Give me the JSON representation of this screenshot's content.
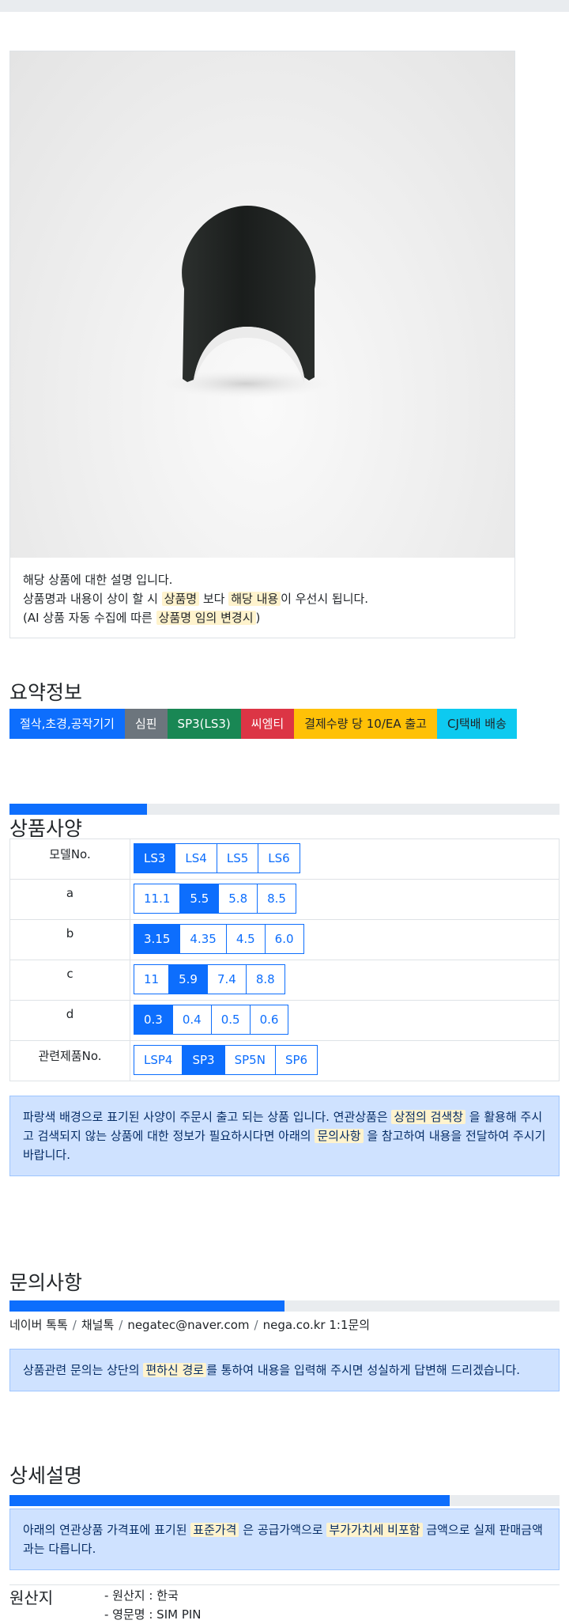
{
  "product": {
    "description_lines": [
      {
        "text": "해당 상품에 대한 설명 입니다."
      },
      {
        "pre": "상품명과 내용이 상이 할 시 ",
        "hl1": "상품명",
        "mid": " 보다 ",
        "hl2": "해당 내용",
        "post": "이 우선시 됩니다."
      },
      {
        "pre": "(AI 상품 자동 수집에 따른 ",
        "hl1": "상품명 임의 변경시",
        "post": ")"
      }
    ]
  },
  "summary": {
    "title": "요약정보",
    "badges": [
      {
        "label": "절삭,초경,공작기기",
        "color": "#0d6efd"
      },
      {
        "label": "심핀",
        "color": "#6c757d"
      },
      {
        "label": "SP3(LS3)",
        "color": "#198754"
      },
      {
        "label": "씨엠티",
        "color": "#dc3545"
      },
      {
        "label": "결제수량 당 10/EA 출고",
        "color": "#ffc107"
      },
      {
        "label": "CJ택배 배송",
        "color": "#0dcaf0"
      }
    ]
  },
  "specs": {
    "title": "상품사양",
    "progress_fraction": 0.25,
    "rows": [
      {
        "label": "모델No.",
        "options": [
          "LS3",
          "LS4",
          "LS5",
          "LS6"
        ],
        "selected": 0
      },
      {
        "label": "a",
        "options": [
          "11.1",
          "5.5",
          "5.8",
          "8.5"
        ],
        "selected": 1
      },
      {
        "label": "b",
        "options": [
          "3.15",
          "4.35",
          "4.5",
          "6.0"
        ],
        "selected": 0
      },
      {
        "label": "c",
        "options": [
          "11",
          "5.9",
          "7.4",
          "8.8"
        ],
        "selected": 1
      },
      {
        "label": "d",
        "options": [
          "0.3",
          "0.4",
          "0.5",
          "0.6"
        ],
        "selected": 0
      },
      {
        "label": "관련제품No.",
        "options": [
          "LSP4",
          "SP3",
          "SP5N",
          "SP6"
        ],
        "selected": 1
      }
    ],
    "notice": {
      "pre": "파랑색 배경으로 표기된 사양이 주문시 출고 되는 상품 입니다. 연관상품은 ",
      "hl1": "상점의 검색창",
      "mid": " 을 활용해 주시고 검색되지 않는 상품에 대한 정보가 필요하시다면 아래의 ",
      "hl2": "문의사항",
      "post": " 을 참고하여 내용을 전달하여 주시기 바랍니다."
    }
  },
  "inquiry": {
    "title": "문의사항",
    "progress_fraction": 0.5,
    "links": [
      "네이버 톡톡",
      "채널톡",
      "negatec@naver.com",
      "nega.co.kr 1:1문의"
    ],
    "separator": "/",
    "notice": {
      "pre": "상품관련 문의는 상단의 ",
      "hl1": "편하신 경로",
      "post": "를 통하여 내용을 입력해 주시면 성실하게 답변해 드리겠습니다."
    }
  },
  "detail": {
    "title": "상세설명",
    "progress_fraction": 0.8,
    "notice": {
      "pre": "아래의 연관상품 가격표에 표기된 ",
      "hl1": "표준가격",
      "mid": " 은 공급가액으로 ",
      "hl2": "부가가치세 비포함",
      "post": " 금액으로 실제 판매금액과는 다릅니다."
    }
  },
  "origin": {
    "label": "원산지",
    "items": [
      "- 원산지 : 한국",
      "- 영문명 : SIM PIN"
    ]
  }
}
